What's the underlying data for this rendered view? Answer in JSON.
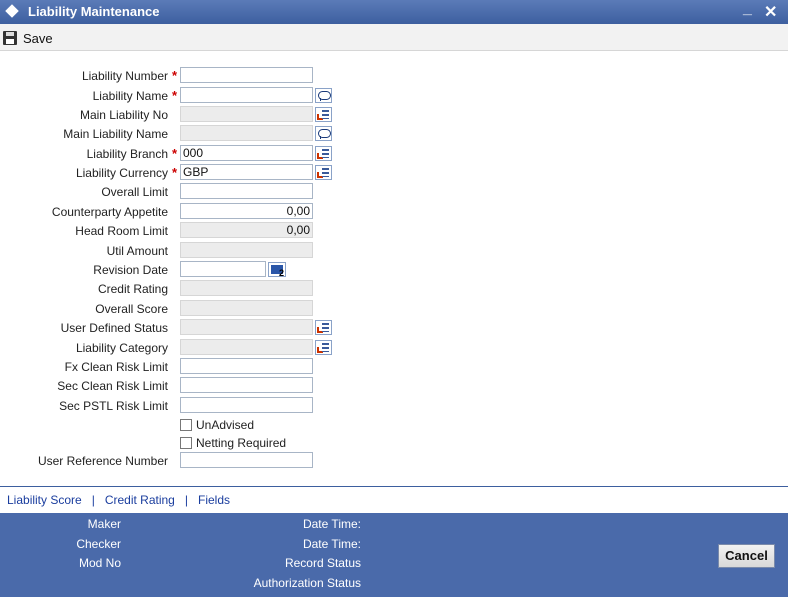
{
  "window": {
    "title": "Liability Maintenance",
    "minimize": "▄",
    "close": "✕"
  },
  "toolbar": {
    "save_label": "Save"
  },
  "fields": {
    "liability_number": {
      "label": "Liability Number",
      "value": ""
    },
    "liability_name": {
      "label": "Liability Name",
      "value": ""
    },
    "main_liability_no": {
      "label": "Main Liability No",
      "value": ""
    },
    "main_liability_name": {
      "label": "Main Liability Name",
      "value": ""
    },
    "liability_branch": {
      "label": "Liability Branch",
      "value": "000"
    },
    "liability_currency": {
      "label": "Liability Currency",
      "value": "GBP"
    },
    "overall_limit": {
      "label": "Overall Limit",
      "value": ""
    },
    "counterparty_appetite": {
      "label": "Counterparty Appetite",
      "value": "0,00"
    },
    "head_room_limit": {
      "label": "Head Room Limit",
      "value": "0,00"
    },
    "util_amount": {
      "label": "Util Amount",
      "value": ""
    },
    "revision_date": {
      "label": "Revision Date",
      "value": ""
    },
    "credit_rating": {
      "label": "Credit Rating",
      "value": ""
    },
    "overall_score": {
      "label": "Overall Score",
      "value": ""
    },
    "user_defined_status": {
      "label": "User Defined Status",
      "value": ""
    },
    "liability_category": {
      "label": "Liability Category",
      "value": ""
    },
    "fx_clean_risk_limit": {
      "label": "Fx Clean Risk Limit",
      "value": ""
    },
    "sec_clean_risk_limit": {
      "label": "Sec Clean Risk Limit",
      "value": ""
    },
    "sec_pstl_risk_limit": {
      "label": "Sec PSTL Risk Limit",
      "value": ""
    },
    "user_reference_number": {
      "label": "User Reference Number",
      "value": ""
    }
  },
  "required_marker": "*",
  "checkboxes": {
    "unadvised": {
      "label": "UnAdvised",
      "checked": false
    },
    "netting_required": {
      "label": "Netting Required",
      "checked": false
    }
  },
  "links": {
    "liability_score": "Liability Score",
    "credit_rating": "Credit Rating",
    "fields": "Fields",
    "separator": "|"
  },
  "footer": {
    "maker": "Maker",
    "checker": "Checker",
    "mod_no": "Mod No",
    "date_time_1": "Date Time:",
    "date_time_2": "Date Time:",
    "record_status": "Record Status",
    "authorization_status": "Authorization Status",
    "cancel": "Cancel"
  },
  "colors": {
    "titlebar": "#3d5f9f",
    "footer": "#4a6aaa",
    "link": "#1a3d9e",
    "required": "#cc0000"
  }
}
